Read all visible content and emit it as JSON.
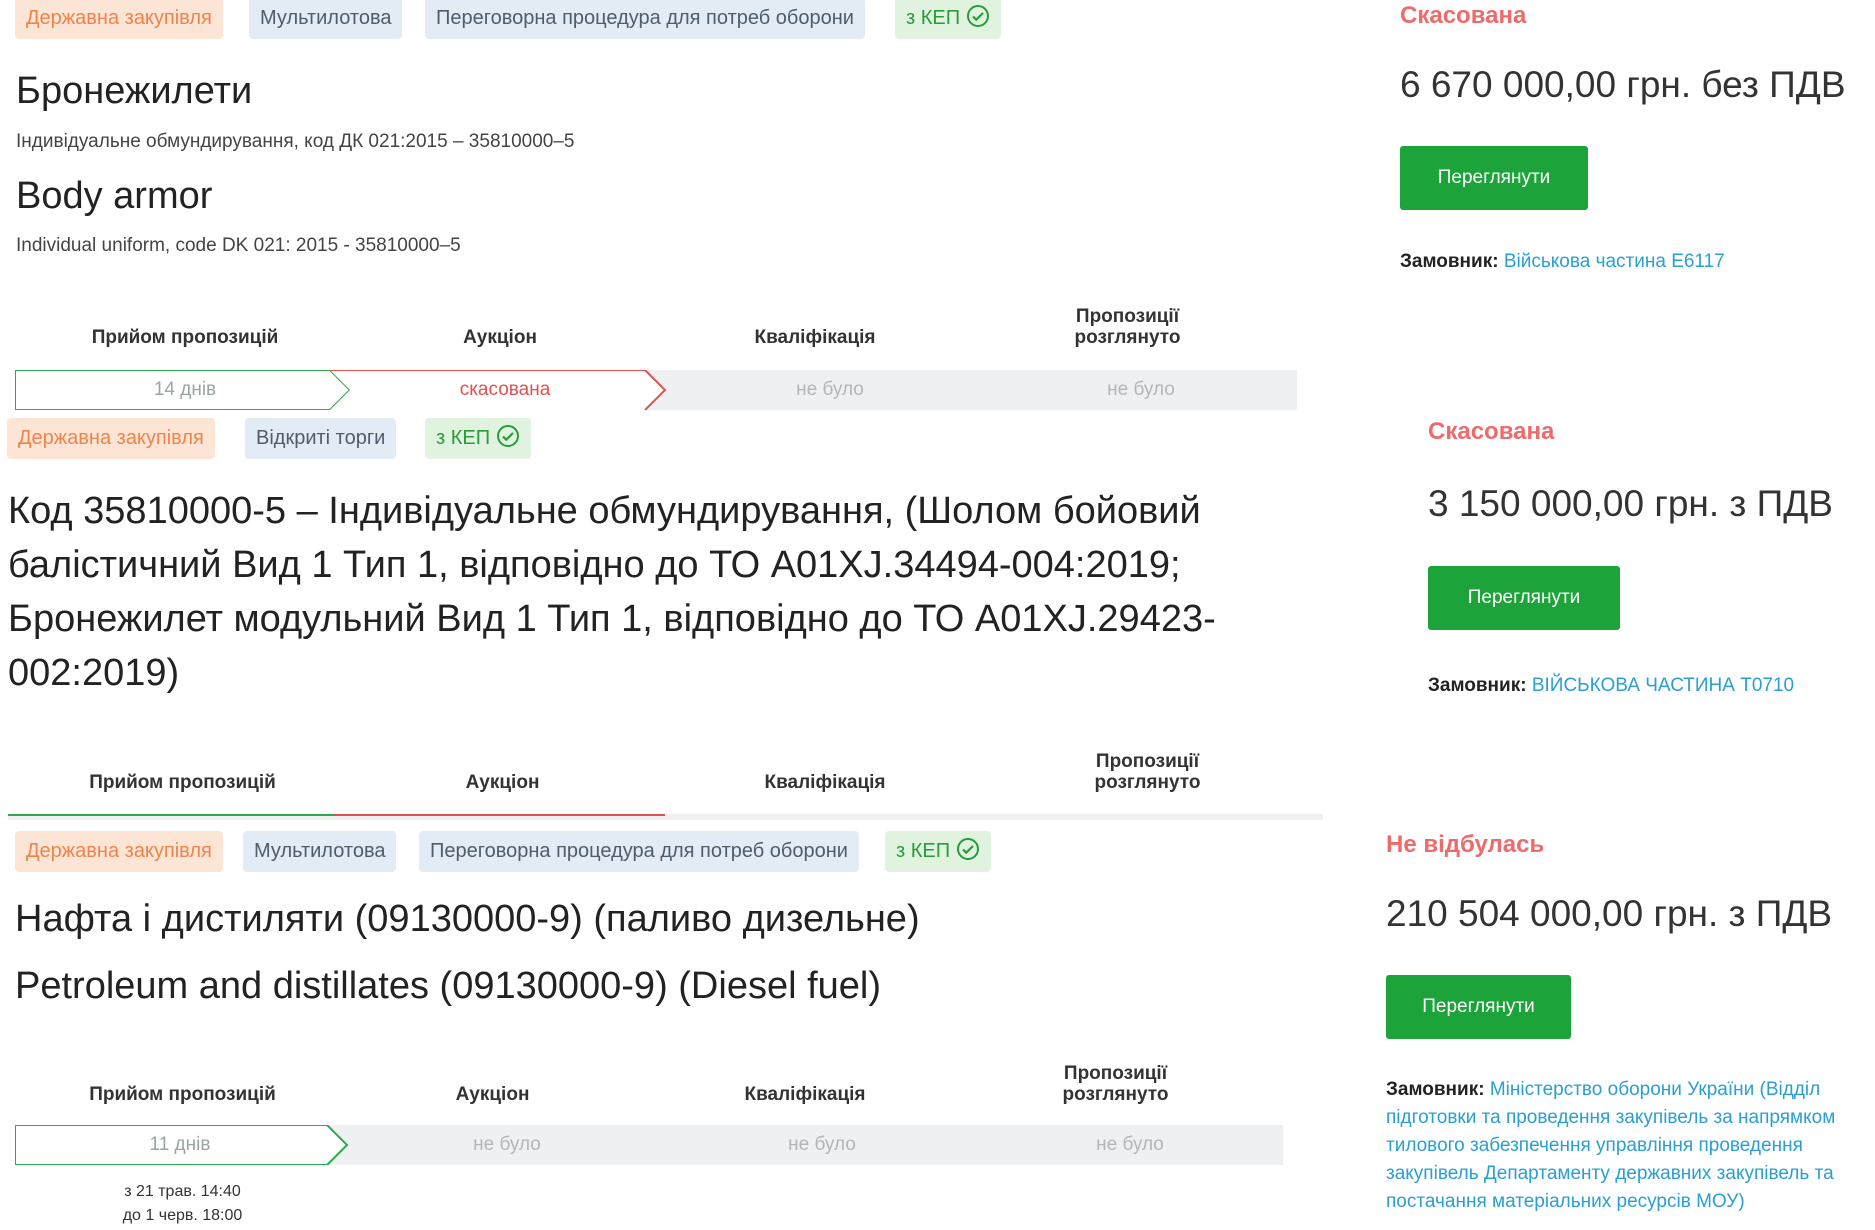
{
  "card1": {
    "tags": [
      "Державна закупівля",
      "Мультилотова",
      "Переговорна процедура для потреб оборони",
      "з КЕП"
    ],
    "title_ua": "Бронежилети",
    "subtitle_ua": "Індивідуальне обмундирування, код ДК 021:2015 – 35810000–5",
    "title_en": "Body armor",
    "subtitle_en": "Individual uniform, code DK 021: 2015 - 35810000–5",
    "stages": [
      "Прийом пропозицій",
      "Аукціон",
      "Кваліфікація",
      "Пропозиції розглянуто"
    ],
    "stage_values": [
      "14 днів",
      "скасована",
      "не було",
      "не було"
    ],
    "status": "Скасована",
    "price": "6 670 000,00 грн. без ПДВ",
    "button": "Переглянути",
    "buyer_label": "Замовник:",
    "buyer": "Військова частина Е6117"
  },
  "card2": {
    "tags": [
      "Державна закупівля",
      "Відкриті торги",
      "з КЕП"
    ],
    "title": "Код 35810000-5 – Індивідуальне обмундирування, (Шолом бойовий балістичний Вид 1 Тип 1, відповідно до ТО А01XJ.34494-004:2019; Бронежилет модульний Вид 1 Тип 1, відповідно до ТО А01XJ.29423-002:2019)",
    "stages": [
      "Прийом пропозицій",
      "Аукціон",
      "Кваліфікація",
      "Пропозиції розглянуто"
    ],
    "status": "Скасована",
    "price": "3 150 000,00 грн. з ПДВ",
    "button": "Переглянути",
    "buyer_label": "Замовник:",
    "buyer": "ВІЙСЬКОВА ЧАСТИНА Т0710"
  },
  "card3": {
    "tags": [
      "Державна закупівля",
      "Мультилотова",
      "Переговорна процедура для потреб оборони",
      "з КЕП"
    ],
    "title_ua": "Нафта і дистиляти (09130000-9) (паливо дизельне)",
    "title_en": "Petroleum and distillates (09130000-9) (Diesel fuel)",
    "stages": [
      "Прийом пропозицій",
      "Аукціон",
      "Кваліфікація",
      "Пропозиції розглянуто"
    ],
    "stage_values": [
      "11 днів",
      "не було",
      "не було",
      "не було"
    ],
    "dates": [
      "з 21 трав. 14:40",
      "до 1 черв. 18:00"
    ],
    "status": "Не відбулась",
    "price": "210 504 000,00 грн. з ПДВ",
    "button": "Переглянути",
    "buyer_label": "Замовник:",
    "buyer": "Міністерство оборони України (Відділ підготовки та проведення закупівель за напрямком тилового забезпечення управління проведення закупівель Департаменту державних закупівель та постачання матеріальних ресурсів МОУ)"
  },
  "icons": {
    "kep": "check-circle-icon"
  },
  "colors": {
    "green": "#1ca33a",
    "status_red": "#ef6a6a",
    "link": "#2a9fd0",
    "tag_orange": "#f0834b"
  }
}
